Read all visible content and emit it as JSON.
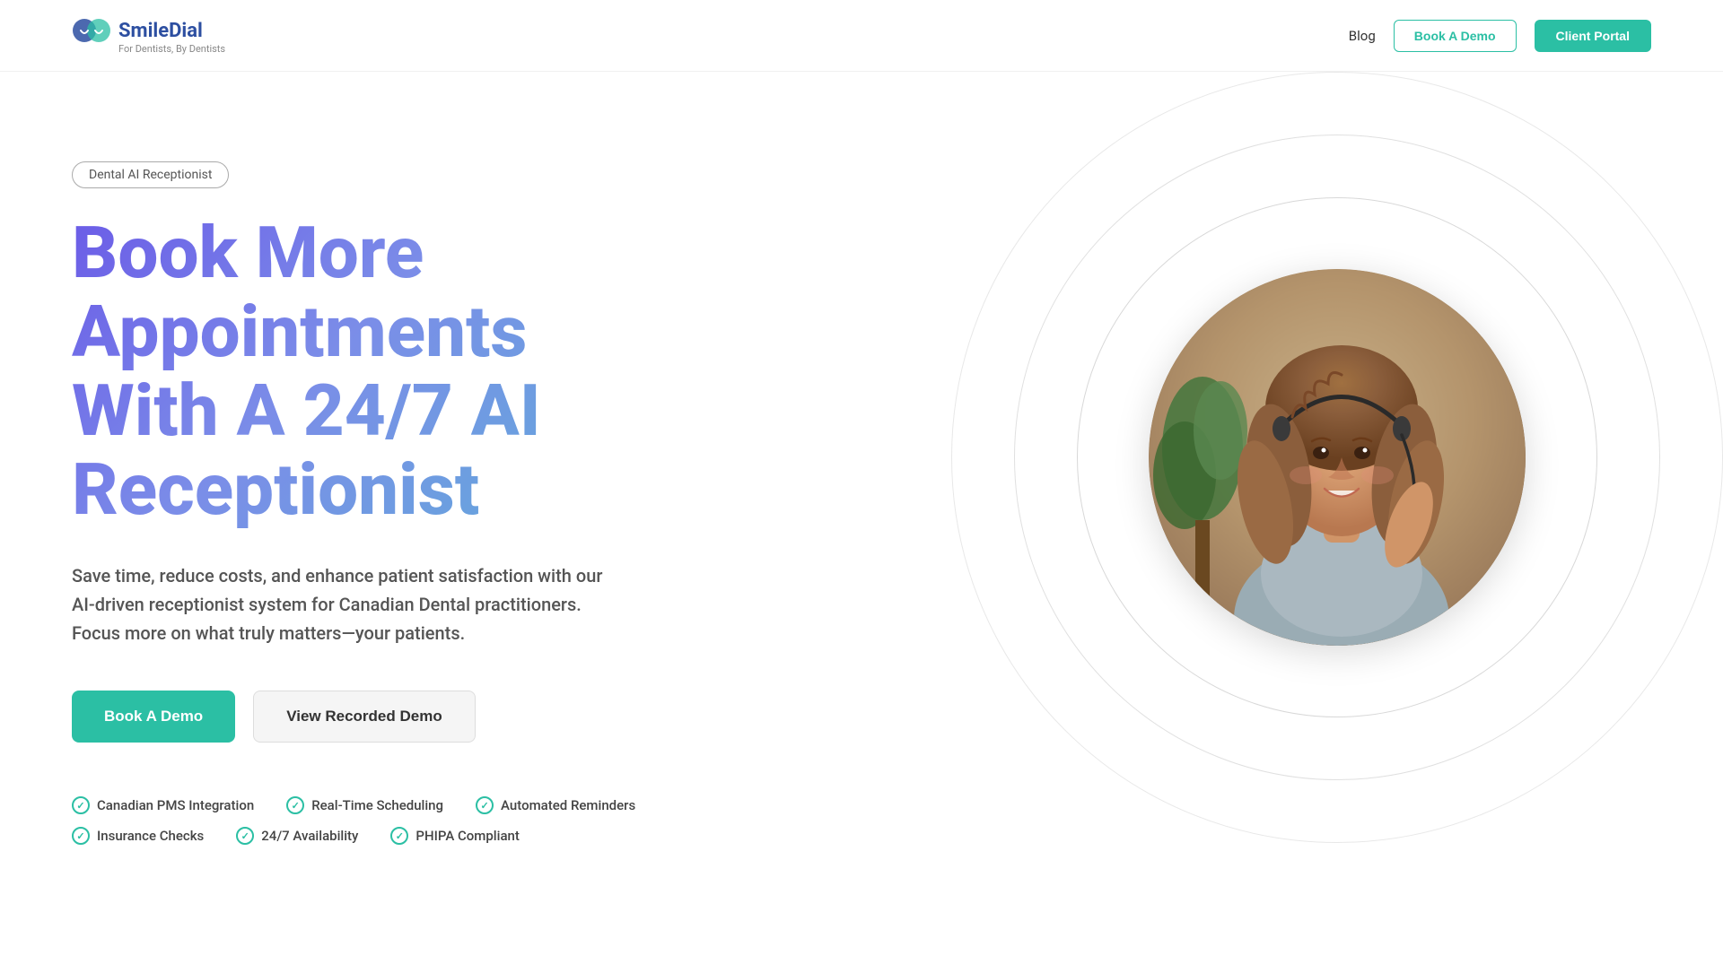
{
  "brand": {
    "name": "SmileDial",
    "tagline": "For Dentists, By Dentists"
  },
  "nav": {
    "blog_label": "Blog",
    "book_demo_label": "Book A Demo",
    "client_portal_label": "Client Portal"
  },
  "hero": {
    "badge": "Dental AI Receptionist",
    "title_line1": "Book More Appointments",
    "title_line2": "With A 24/7 AI Receptionist",
    "subtitle": "Save time, reduce costs, and enhance patient satisfaction with our AI-driven receptionist system for Canadian Dental practitioners. Focus more on what truly matters—your patients.",
    "btn_primary": "Book A Demo",
    "btn_secondary": "View Recorded Demo"
  },
  "features": {
    "row1": [
      {
        "label": "Canadian PMS Integration"
      },
      {
        "label": "Real-Time Scheduling"
      },
      {
        "label": "Automated Reminders"
      }
    ],
    "row2": [
      {
        "label": "Insurance Checks"
      },
      {
        "label": "24/7 Availability"
      },
      {
        "label": "PHIPA Compliant"
      }
    ]
  },
  "colors": {
    "teal": "#2bbfa4",
    "purple_grad_start": "#6b5ce7",
    "purple_grad_end": "#5ab4d6",
    "navy": "#2d4fa1"
  }
}
